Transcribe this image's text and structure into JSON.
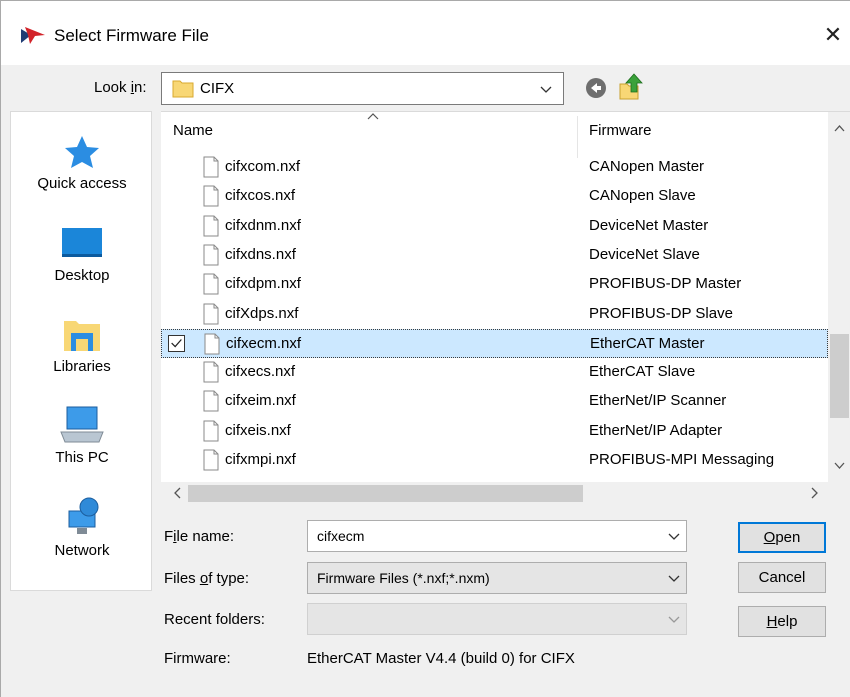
{
  "window": {
    "title": "Select Firmware File",
    "close_glyph": "✕"
  },
  "lookin": {
    "label": "Look in:",
    "value": "CIFX"
  },
  "places": [
    {
      "label": "Quick access",
      "icon": "star-icon"
    },
    {
      "label": "Desktop",
      "icon": "desktop-icon"
    },
    {
      "label": "Libraries",
      "icon": "libraries-icon"
    },
    {
      "label": "This PC",
      "icon": "computer-icon"
    },
    {
      "label": "Network",
      "icon": "network-icon"
    }
  ],
  "filelist": {
    "columns": [
      "Name",
      "Firmware"
    ],
    "rows": [
      {
        "name": "cifxcom.nxf",
        "firmware": "CANopen Master"
      },
      {
        "name": "cifxcos.nxf",
        "firmware": "CANopen Slave"
      },
      {
        "name": "cifxdnm.nxf",
        "firmware": "DeviceNet Master"
      },
      {
        "name": "cifxdns.nxf",
        "firmware": "DeviceNet Slave"
      },
      {
        "name": "cifxdpm.nxf",
        "firmware": "PROFIBUS-DP Master"
      },
      {
        "name": "cifXdps.nxf",
        "firmware": "PROFIBUS-DP Slave"
      },
      {
        "name": "cifxecm.nxf",
        "firmware": "EtherCAT Master",
        "selected": true
      },
      {
        "name": "cifxecs.nxf",
        "firmware": "EtherCAT Slave"
      },
      {
        "name": "cifxeim.nxf",
        "firmware": "EtherNet/IP Scanner"
      },
      {
        "name": "cifxeis.nxf",
        "firmware": "EtherNet/IP Adapter"
      },
      {
        "name": "cifxmpi.nxf",
        "firmware": "PROFIBUS-MPI Messaging"
      }
    ]
  },
  "form": {
    "file_name_label": "File name:",
    "file_name_value": "cifxecm",
    "files_of_type_label": "Files of type:",
    "files_of_type_value": "Firmware Files (*.nxf;*.nxm)",
    "recent_folders_label": "Recent folders:",
    "recent_folders_value": "",
    "firmware_label": "Firmware:",
    "firmware_value": "EtherCAT Master V4.4 (build 0) for CIFX"
  },
  "buttons": {
    "open": "Open",
    "cancel": "Cancel",
    "help": "Help"
  },
  "colors": {
    "selection": "#cce8ff",
    "accent": "#0078d7",
    "star": "#2b8de2"
  }
}
